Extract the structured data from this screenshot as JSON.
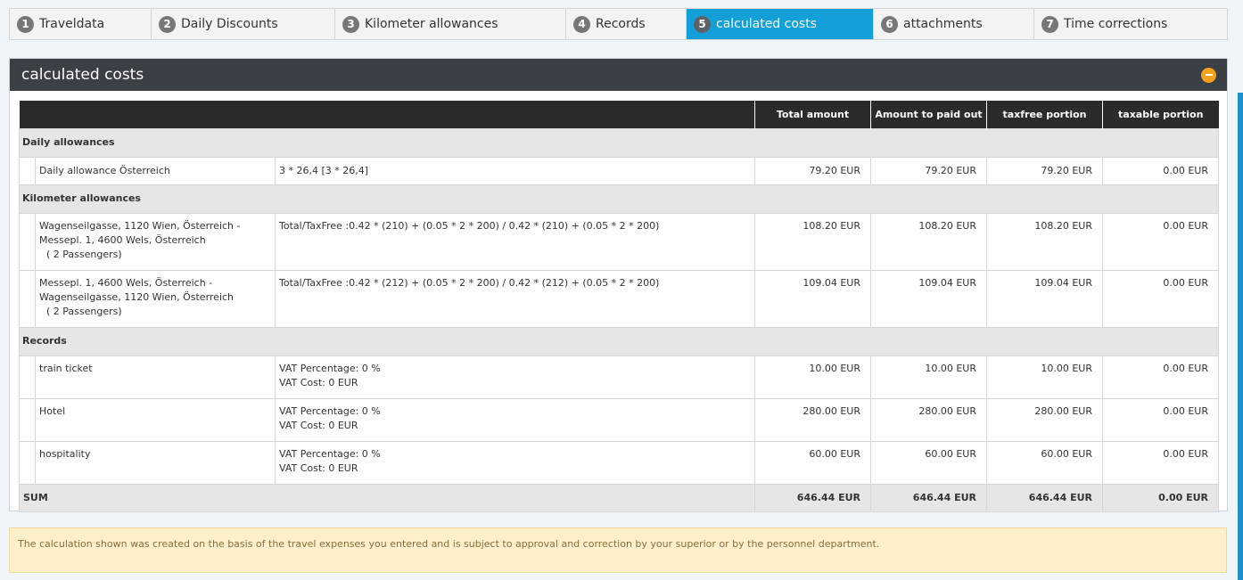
{
  "steps": [
    {
      "num": "1",
      "label": "Traveldata"
    },
    {
      "num": "2",
      "label": "Daily Discounts"
    },
    {
      "num": "3",
      "label": "Kilometer allowances"
    },
    {
      "num": "4",
      "label": "Records"
    },
    {
      "num": "5",
      "label": "calculated costs"
    },
    {
      "num": "6",
      "label": "attachments"
    },
    {
      "num": "7",
      "label": "Time corrections"
    }
  ],
  "panel": {
    "title": "calculated costs"
  },
  "table": {
    "headers": [
      "Total amount",
      "Amount to paid out",
      "taxfree portion",
      "taxable portion"
    ],
    "groups": {
      "daily": "Daily allowances",
      "km": "Kilometer allowances",
      "records": "Records"
    },
    "daily_rows": [
      {
        "desc": "Daily allowance   Österreich",
        "detail": "3 * 26,4 [3 * 26,4]",
        "total": "79.20 EUR",
        "paid": "79.20 EUR",
        "taxfree": "79.20 EUR",
        "taxable": "0.00 EUR"
      }
    ],
    "km_rows": [
      {
        "desc_1": "Wagenseilgasse, 1120 Wien, Österreich -",
        "desc_2": "Messepl. 1, 4600 Wels, Österreich",
        "desc_3": "( 2   Passengers)",
        "detail": "Total/TaxFree :0.42 * (210) + (0.05 * 2 * 200) / 0.42 * (210) + (0.05 * 2 * 200)",
        "total": "108.20 EUR",
        "paid": "108.20 EUR",
        "taxfree": "108.20 EUR",
        "taxable": "0.00 EUR"
      },
      {
        "desc_1": "Messepl. 1, 4600 Wels, Österreich -",
        "desc_2": "Wagenseilgasse, 1120 Wien, Österreich",
        "desc_3": "( 2   Passengers)",
        "detail": "Total/TaxFree :0.42 * (212) + (0.05 * 2 * 200) / 0.42 * (212) + (0.05 * 2 * 200)",
        "total": "109.04 EUR",
        "paid": "109.04 EUR",
        "taxfree": "109.04 EUR",
        "taxable": "0.00 EUR"
      }
    ],
    "record_rows": [
      {
        "desc": "train ticket",
        "vat_pct": "VAT Percentage:  0 %",
        "vat_cost": "VAT Cost:  0 EUR",
        "total": "10.00 EUR",
        "paid": "10.00 EUR",
        "taxfree": "10.00 EUR",
        "taxable": "0.00 EUR"
      },
      {
        "desc": "Hotel",
        "vat_pct": "VAT Percentage:  0 %",
        "vat_cost": "VAT Cost:  0 EUR",
        "total": "280.00 EUR",
        "paid": "280.00 EUR",
        "taxfree": "280.00 EUR",
        "taxable": "0.00 EUR"
      },
      {
        "desc": "hospitality",
        "vat_pct": "VAT Percentage:  0 %",
        "vat_cost": "VAT Cost:  0 EUR",
        "total": "60.00 EUR",
        "paid": "60.00 EUR",
        "taxfree": "60.00 EUR",
        "taxable": "0.00 EUR"
      }
    ],
    "sum": {
      "label": "SUM",
      "total": "646.44 EUR",
      "paid": "646.44 EUR",
      "taxfree": "646.44 EUR",
      "taxable": "0.00 EUR"
    }
  },
  "notice": "The calculation shown was created on the basis of the travel expenses you entered and is subject to approval and correction by your superior or by the personnel department.",
  "colors": {
    "active_step": "#13a0d8",
    "panel_header": "#3a4046",
    "collapse": "#f4a11e",
    "notice_bg": "#fdf0cb"
  }
}
